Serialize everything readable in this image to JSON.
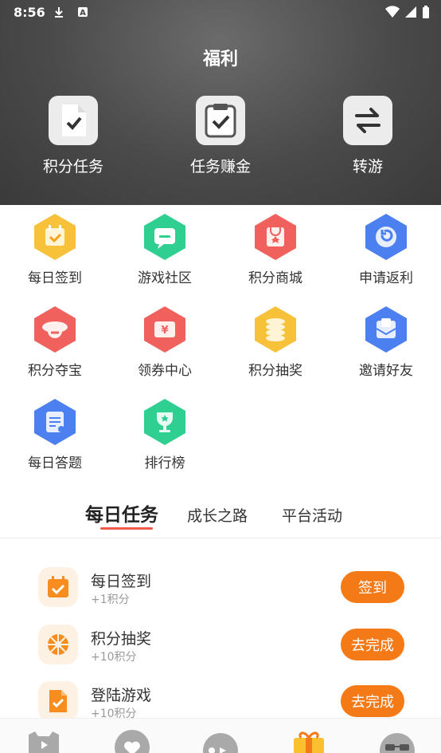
{
  "status_bar": {
    "time": "8:56",
    "left_icons": [
      "download-icon",
      "a-icon"
    ],
    "right_icons": [
      "wifi-icon",
      "signal-icon",
      "battery-icon"
    ]
  },
  "header": {
    "title": "福利",
    "actions": [
      {
        "label": "积分任务",
        "icon": "document-check-icon"
      },
      {
        "label": "任务赚金",
        "icon": "clipboard-check-icon"
      },
      {
        "label": "转游",
        "icon": "swap-arrows-icon"
      }
    ]
  },
  "grid": [
    {
      "label": "每日签到",
      "icon": "calendar-icon",
      "color": "#f8c13a"
    },
    {
      "label": "游戏社区",
      "icon": "chat-icon",
      "color": "#2fcf92"
    },
    {
      "label": "积分商城",
      "icon": "shop-icon",
      "color": "#f0605c"
    },
    {
      "label": "申请返利",
      "icon": "refresh-icon",
      "color": "#4c7ff0"
    },
    {
      "label": "积分夺宝",
      "icon": "treasure-icon",
      "color": "#f0605c"
    },
    {
      "label": "领券中心",
      "icon": "coupon-icon",
      "color": "#f0605c"
    },
    {
      "label": "积分抽奖",
      "icon": "coins-icon",
      "color": "#f8c13a"
    },
    {
      "label": "邀请好友",
      "icon": "invite-icon",
      "color": "#4c7ff0"
    },
    {
      "label": "每日答题",
      "icon": "quiz-icon",
      "color": "#4c7ff0"
    },
    {
      "label": "排行榜",
      "icon": "trophy-icon",
      "color": "#2fcf92"
    }
  ],
  "tabs": [
    {
      "label": "每日任务",
      "active": true
    },
    {
      "label": "成长之路",
      "active": false
    },
    {
      "label": "平台活动",
      "active": false
    }
  ],
  "tasks": [
    {
      "title": "每日签到",
      "reward": "+1积分",
      "button": "签到",
      "icon": "calendar-check-icon"
    },
    {
      "title": "积分抽奖",
      "reward": "+10积分",
      "button": "去完成",
      "icon": "wheel-icon"
    },
    {
      "title": "登陆游戏",
      "reward": "+10积分",
      "button": "去完成",
      "icon": "doc-check-icon"
    }
  ],
  "bottom_nav": [
    {
      "icon": "game-icon",
      "active": false
    },
    {
      "icon": "heart-icon",
      "active": false
    },
    {
      "icon": "controller-icon",
      "active": false
    },
    {
      "icon": "gift-icon",
      "active": true
    },
    {
      "icon": "glasses-icon",
      "active": false
    }
  ],
  "colors": {
    "accent": "#f47a17",
    "tab_underline": "#ef5a4a"
  }
}
